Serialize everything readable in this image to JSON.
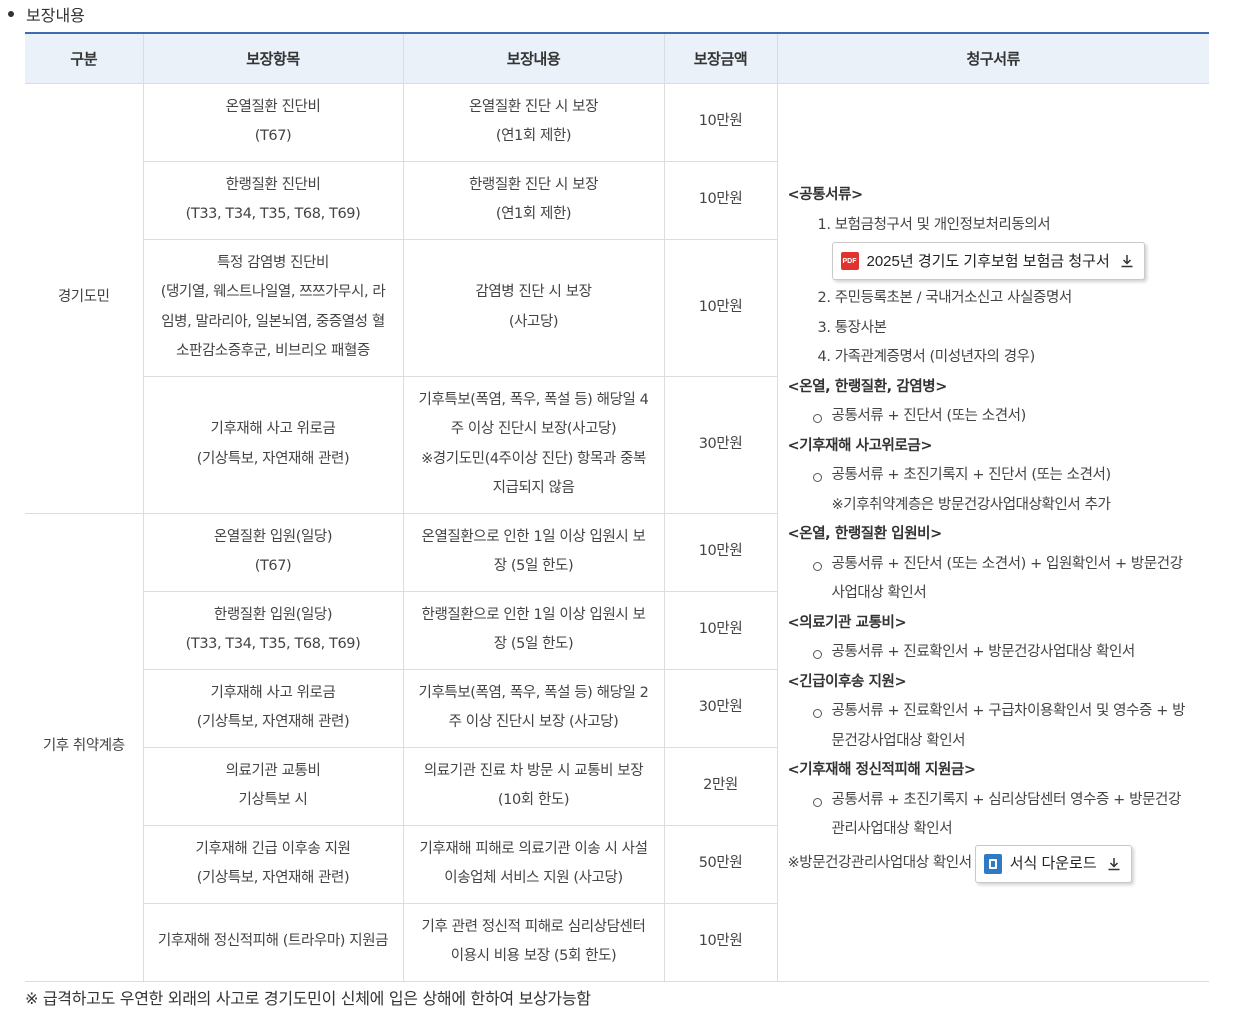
{
  "section_title": "보장내용",
  "headers": [
    "구분",
    "보장항목",
    "보장내용",
    "보장금액",
    "청구서류"
  ],
  "groups": [
    "경기도민",
    "기후 취약계층"
  ],
  "rows": [
    {
      "item": [
        "온열질환 진단비",
        "(T67)"
      ],
      "content": [
        "온열질환 진단 시 보장",
        "(연1회 제한)"
      ],
      "amount": "10만원"
    },
    {
      "item": [
        "한랭질환 진단비",
        "(T33, T34, T35, T68, T69)"
      ],
      "content": [
        "한랭질환 진단 시 보장",
        "(연1회 제한)"
      ],
      "amount": "10만원"
    },
    {
      "item": [
        "특정 감염병 진단비",
        "(댕기열, 웨스트나일열, 쯔쯔가무시, 라",
        "임병, 말라리아, 일본뇌염, 중증열성 혈",
        "소판감소증후군, 비브리오 패혈증"
      ],
      "content": [
        "감염병 진단 시 보장",
        "(사고당)"
      ],
      "amount": "10만원"
    },
    {
      "item": [
        "기후재해 사고 위로금",
        "(기상특보, 자연재해 관련)"
      ],
      "content": [
        "기후특보(폭염, 폭우, 폭설 등) 해당일 4",
        "주 이상 진단시 보장(사고당)",
        "※경기도민(4주이상 진단) 항목과 중복",
        "지급되지 않음"
      ],
      "amount": "30만원"
    },
    {
      "item": [
        "온열질환 입원(일당)",
        "(T67)"
      ],
      "content": [
        "온열질환으로 인한 1일 이상 입원시 보",
        "장 (5일 한도)"
      ],
      "amount": "10만원"
    },
    {
      "item": [
        "한랭질환 입원(일당)",
        "(T33, T34, T35, T68, T69)"
      ],
      "content": [
        "한랭질환으로 인한 1일 이상 입원시 보",
        "장 (5일 한도)"
      ],
      "amount": "10만원"
    },
    {
      "item": [
        "기후재해 사고 위로금",
        "(기상특보, 자연재해 관련)"
      ],
      "content": [
        "기후특보(폭염, 폭우, 폭설 등) 해당일 2",
        "주 이상 진단시 보장 (사고당)"
      ],
      "amount": "30만원"
    },
    {
      "item": [
        "의료기관 교통비",
        "기상특보 시"
      ],
      "content": [
        "의료기관 진료 차 방문 시 교통비 보장",
        "(10회 한도)"
      ],
      "amount": "2만원"
    },
    {
      "item": [
        "기후재해 긴급 이후송 지원",
        "(기상특보, 자연재해 관련)"
      ],
      "content": [
        "기후재해 피해로 의료기관 이송 시 사설",
        "이송업체 서비스 지원 (사고당)"
      ],
      "amount": "50만원"
    },
    {
      "item": [
        "기후재해 정신적피해 (트라우마) 지원금"
      ],
      "content": [
        "기후 관련 정신적 피해로 심리상담센터",
        "이용시 비용 보장 (5회 한도)"
      ],
      "amount": "10만원"
    }
  ],
  "docs": {
    "common_heading": "<공통서류>",
    "common_1": "1. 보험금청구서 및 개인정보처리동의서",
    "pdf_button": "2025년 경기도 기후보험 보험금 청구서",
    "pdf_icon_text": "PDF",
    "common_2": "2. 주민등록초본 / 국내거소신고 사실증명서",
    "common_3": "3. 통장사본",
    "common_4": "4. 가족관계증명서 (미성년자의 경우)",
    "h_diag": "<온열, 한랭질환, 감염병>",
    "d_diag": "공통서류 + 진단서 (또는 소견서)",
    "h_comfort": "<기후재해 사고위로금>",
    "d_comfort": "공통서류 + 초진기록지 + 진단서 (또는 소견서)",
    "n_comfort": "※기후취약계층은 방문건강사업대상확인서 추가",
    "h_hosp": "<온열, 한랭질환 입원비>",
    "d_hosp_1": "공통서류 + 진단서 (또는 소견서) + 입원확인서 + 방문건강",
    "d_hosp_2": "사업대상 확인서",
    "h_transport": "<의료기관 교통비>",
    "d_transport": "공통서류 + 진료확인서 + 방문건강사업대상 확인서",
    "h_emerg": "<긴급이후송 지원>",
    "d_emerg_1": "공통서류 + 진료확인서 + 구급차이용확인서 및 영수증 + 방",
    "d_emerg_2": "문건강사업대상 확인서",
    "h_mental": "<기후재해 정신적피해 지원금>",
    "d_mental_1": "공통서류 + 초진기록지 + 심리상담센터 영수증 + 방문건강",
    "d_mental_2": "관리사업대상 확인서",
    "final_note": "※방문건강관리사업대상 확인서",
    "form_button": "서식 다운로드"
  },
  "footnote": "※ 급격하고도 우연한 외래의 사고로 경기도민이 신체에 입은 상해에 한하여 보상가능함"
}
